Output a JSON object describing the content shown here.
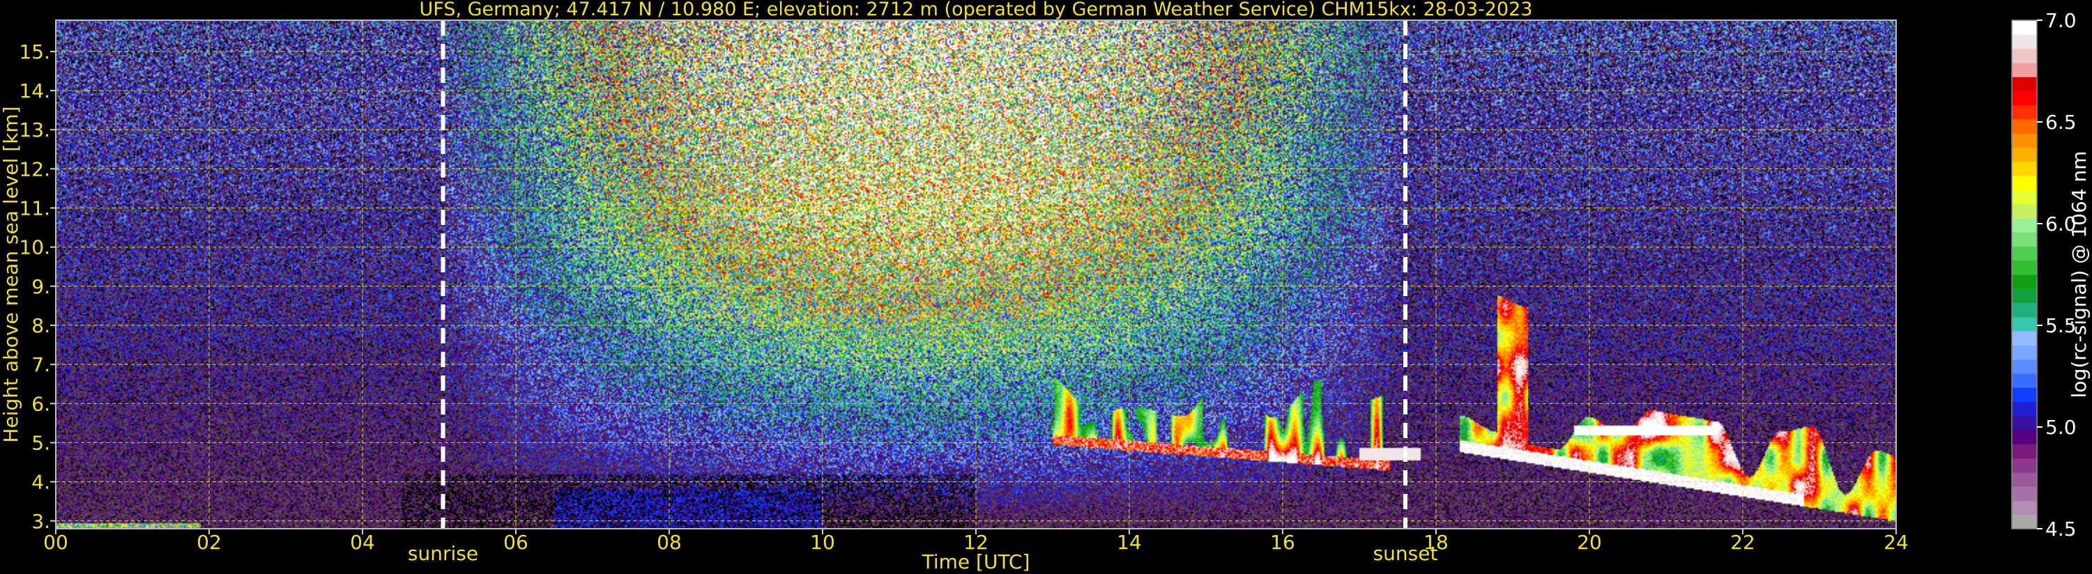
{
  "chart_data": {
    "type": "heatmap",
    "title": "UFS, Germany; 47.417 N / 10.980 E; elevation: 2712 m  (operated by German Weather Service)    CHM15kx: 28-03-2023",
    "xlabel": "Time [UTC]",
    "ylabel": "Height above mean sea level [km]",
    "xlim": [
      0,
      24
    ],
    "ylim": [
      2.8,
      15.8
    ],
    "x_ticks": [
      "00",
      "02",
      "04",
      "06",
      "08",
      "10",
      "12",
      "14",
      "16",
      "18",
      "20",
      "22",
      "24"
    ],
    "y_ticks": [
      "3.",
      "4.",
      "5.",
      "6.",
      "7.",
      "8.",
      "9.",
      "10.",
      "11.",
      "12.",
      "13.",
      "14.",
      "15."
    ],
    "grid": true,
    "grid_color": "#e6e600",
    "markers": [
      {
        "label": "sunrise",
        "time": 5.05
      },
      {
        "label": "sunset",
        "time": 17.6
      }
    ],
    "colorbar": {
      "label": "log(rc-signal) @ 1064 nm",
      "range": [
        4.5,
        7.0
      ],
      "tick_labels": [
        "4.5",
        "5.0",
        "5.5",
        "6.0",
        "6.5",
        "7.0"
      ],
      "colors": [
        "#a9a9a9",
        "#b28db2",
        "#a870a8",
        "#9a5a9a",
        "#8b3a8b",
        "#7a1a7a",
        "#550080",
        "#3a10a0",
        "#2020d0",
        "#1040ff",
        "#3a6cff",
        "#5a8cff",
        "#7aa6ff",
        "#96baff",
        "#38c8b0",
        "#20b080",
        "#10a040",
        "#129e12",
        "#30c030",
        "#50d050",
        "#7ae07a",
        "#9af09a",
        "#c8f060",
        "#e6ff30",
        "#ffff00",
        "#ffd700",
        "#ffb000",
        "#ff9000",
        "#ff6a00",
        "#ff3000",
        "#ff0000",
        "#e00000",
        "#f0a0a0",
        "#f0c8c8",
        "#f0e6e6",
        "#ffffff"
      ]
    },
    "features": [
      {
        "kind": "cloud",
        "start": 13.0,
        "end": 17.5,
        "base_km": 4.4,
        "top_km": 7.0
      },
      {
        "kind": "cloud",
        "start": 17.6,
        "end": 24.0,
        "base_km": 2.9,
        "top_km": 8.6
      },
      {
        "kind": "background",
        "description_values": {
          "peak_time": 9.5,
          "peak_height_km": 15.0
        }
      }
    ]
  }
}
